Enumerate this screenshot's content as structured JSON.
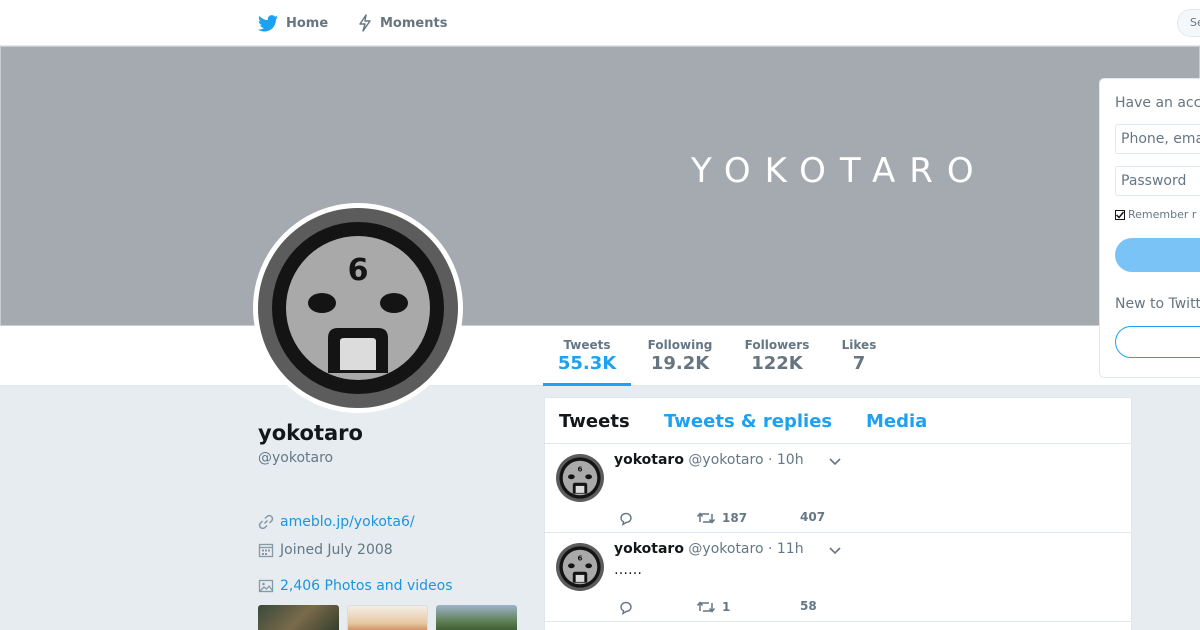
{
  "nav": {
    "home_label": "Home",
    "moments_label": "Moments",
    "search_placeholder": "Se",
    "have_account_hint": "H"
  },
  "banner": {
    "text": "YOKOTARO"
  },
  "stats": {
    "tweets": {
      "label": "Tweets",
      "value": "55.3K"
    },
    "following": {
      "label": "Following",
      "value": "19.2K"
    },
    "followers": {
      "label": "Followers",
      "value": "122K"
    },
    "likes": {
      "label": "Likes",
      "value": "7"
    },
    "active": "tweets"
  },
  "profile": {
    "name": "yokotaro",
    "handle": "@yokotaro",
    "url": "ameblo.jp/yokota6/",
    "joined": "Joined July 2008",
    "photos_label": "2,406 Photos and videos"
  },
  "timeline": {
    "tabs": [
      "Tweets",
      "Tweets & replies",
      "Media"
    ],
    "active_tab": "Tweets",
    "tweets": [
      {
        "name": "yokotaro",
        "handle": "@yokotaro",
        "dot": "·",
        "time": "10h",
        "text": "",
        "retweets": "187",
        "likes": "407"
      },
      {
        "name": "yokotaro",
        "handle": "@yokotaro",
        "dot": "·",
        "time": "11h",
        "text": "……",
        "retweets": "1",
        "likes": "58"
      }
    ]
  },
  "login": {
    "title": "Have an acc",
    "phone_placeholder": "Phone, emai",
    "password_placeholder": "Password",
    "remember_label": "Remember r",
    "new_to": "New to Twitt"
  },
  "colors": {
    "accent": "#1da1f2",
    "banner": "#a4aab0",
    "background": "#e6ecf0"
  }
}
